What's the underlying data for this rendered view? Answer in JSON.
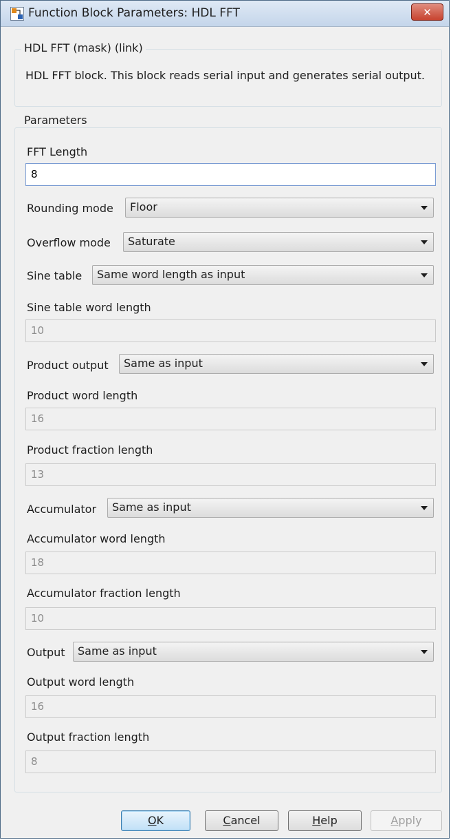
{
  "window": {
    "title": "Function Block Parameters: HDL FFT",
    "close_symbol": "✕"
  },
  "mask_group": {
    "legend": "HDL FFT  (mask) (link)",
    "description": "HDL FFT block. This block reads serial input and generates serial output."
  },
  "params_group": {
    "legend": "Parameters"
  },
  "fields": {
    "fft_length": {
      "label": "FFT Length",
      "value": "8"
    },
    "rounding_mode": {
      "label": "Rounding mode",
      "value": "Floor"
    },
    "overflow_mode": {
      "label": "Overflow mode",
      "value": "Saturate"
    },
    "sine_table": {
      "label": "Sine table",
      "value": "Same word length as input"
    },
    "sine_table_word_length": {
      "label": "Sine table word length",
      "value": "10"
    },
    "product_output": {
      "label": "Product output",
      "value": "Same as input"
    },
    "product_word_length": {
      "label": "Product word length",
      "value": "16"
    },
    "product_fraction_length": {
      "label": "Product fraction length",
      "value": "13"
    },
    "accumulator": {
      "label": "Accumulator",
      "value": "Same as input"
    },
    "accumulator_word_length": {
      "label": "Accumulator word length",
      "value": "18"
    },
    "accumulator_fraction_length": {
      "label": "Accumulator fraction length",
      "value": "10"
    },
    "output": {
      "label": "Output",
      "value": "Same as input"
    },
    "output_word_length": {
      "label": "Output word length",
      "value": "16"
    },
    "output_fraction_length": {
      "label": "Output fraction length",
      "value": "8"
    }
  },
  "buttons": {
    "ok": {
      "mnemonic": "O",
      "rest": "K"
    },
    "cancel": {
      "mnemonic": "C",
      "rest": "ancel"
    },
    "help": {
      "mnemonic": "H",
      "rest": "elp"
    },
    "apply": {
      "mnemonic": "A",
      "rest": "pply"
    }
  },
  "icons": {
    "app": "simulink-block-icon",
    "dropdown": "chevron-down-icon",
    "close": "close-icon"
  },
  "colors": {
    "titlebar": "#c4d5ea",
    "close_button": "#c7432f",
    "dialog_bg": "#f0f0f0"
  }
}
